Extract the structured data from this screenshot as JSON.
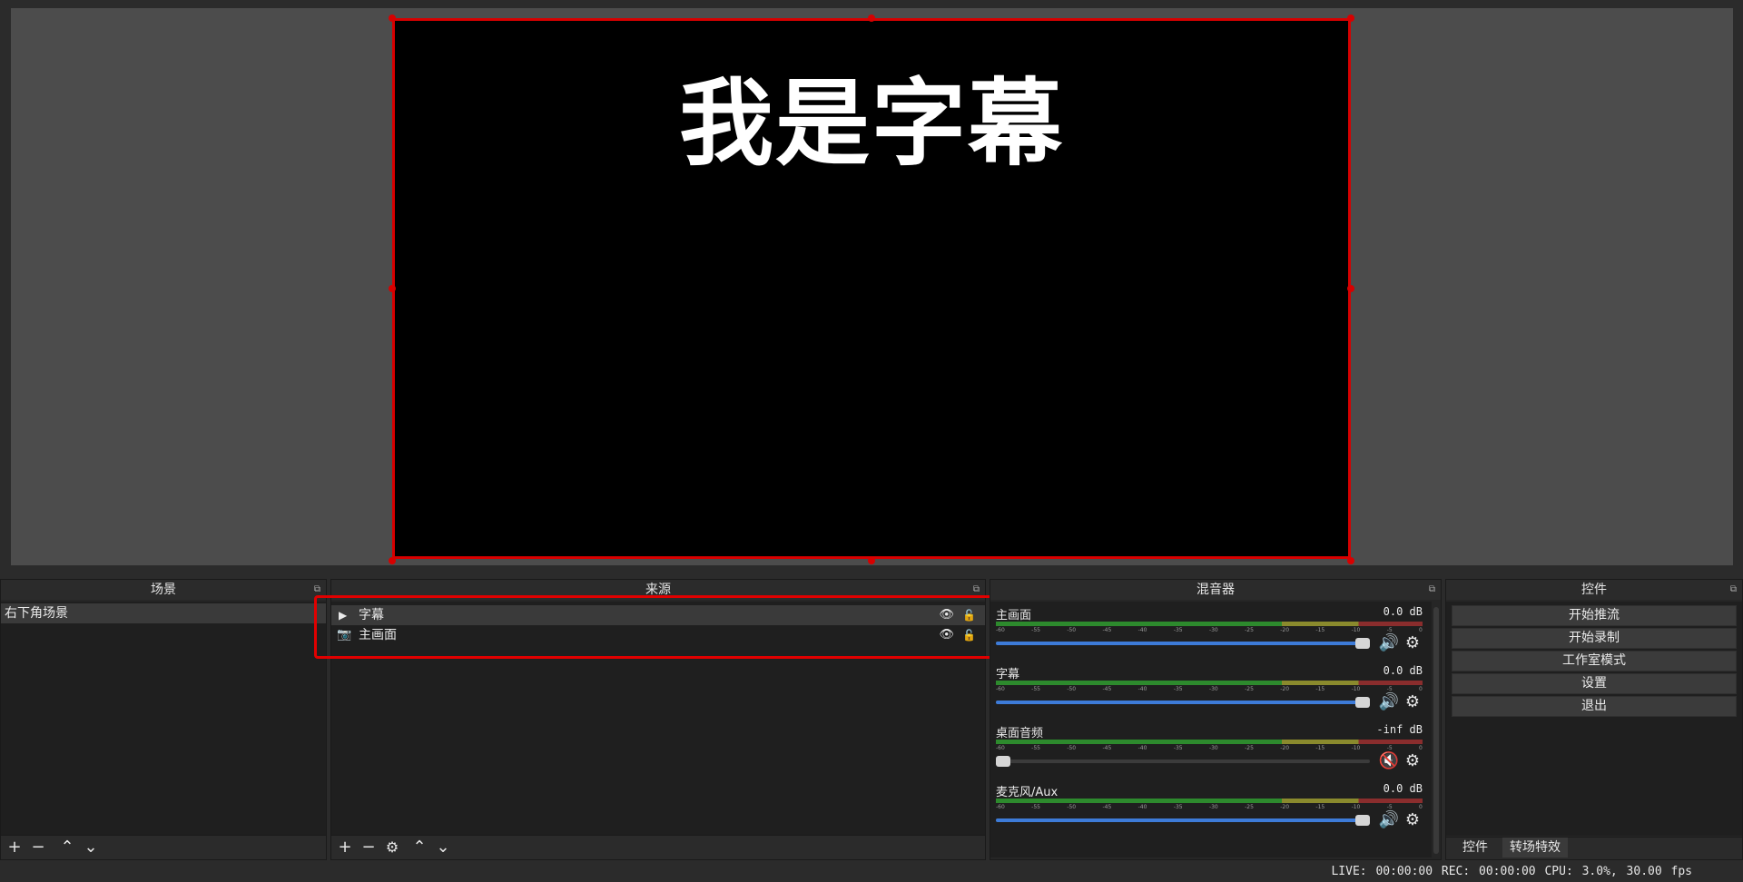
{
  "preview": {
    "canvas_text": "我是字幕"
  },
  "scenes": {
    "title": "场景",
    "items": [
      {
        "label": "右下角场景"
      }
    ],
    "toolbar": {
      "add": "+",
      "remove": "−",
      "up": "⌃",
      "down": "⌄"
    }
  },
  "sources": {
    "title": "来源",
    "items": [
      {
        "label": "字幕",
        "icon": "play-icon"
      },
      {
        "label": "主画面",
        "icon": "camera-icon"
      }
    ]
  },
  "mixer": {
    "title": "混音器",
    "ticks": [
      "-60",
      "-55",
      "-50",
      "-45",
      "-40",
      "-35",
      "-30",
      "-25",
      "-20",
      "-15",
      "-10",
      "-5",
      "0"
    ],
    "channels": [
      {
        "name": "主画面",
        "db": "0.0 dB",
        "level": 1.0,
        "muted": false
      },
      {
        "name": "字幕",
        "db": "0.0 dB",
        "level": 1.0,
        "muted": false
      },
      {
        "name": "桌面音频",
        "db": "-inf dB",
        "level": 0.0,
        "muted": true
      },
      {
        "name": "麦克风/Aux",
        "db": "0.0 dB",
        "level": 1.0,
        "muted": false
      }
    ]
  },
  "controls": {
    "title": "控件",
    "buttons": {
      "start_stream": "开始推流",
      "start_record": "开始录制",
      "studio_mode": "工作室模式",
      "settings": "设置",
      "exit": "退出"
    },
    "tabs": {
      "controls": "控件",
      "transitions": "转场特效"
    }
  },
  "status": {
    "text": "LIVE: 00:00:00   REC: 00:00:00   CPU: 3.0%, 30.00 fps"
  },
  "colors": {
    "selection": "#d70000",
    "fader": "#3d7bd8",
    "mute": "#d70000"
  }
}
